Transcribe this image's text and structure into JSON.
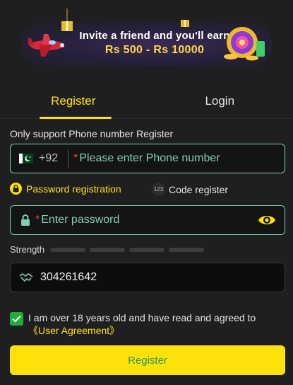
{
  "banner": {
    "line1": "Invite a friend and you'll earn",
    "line2": "Rs 500 - Rs 10000"
  },
  "tabs": [
    {
      "label": "Register",
      "active": true
    },
    {
      "label": "Login",
      "active": false
    }
  ],
  "note": "Only support Phone number Register",
  "phone": {
    "country_code": "+92",
    "required_mark": "*",
    "placeholder": "Please enter Phone number",
    "value": ""
  },
  "modes": {
    "password_label": "Password registration",
    "code_badge": "123",
    "code_label": "Code register",
    "selected": "password"
  },
  "password": {
    "required_mark": "*",
    "placeholder": "Enter password",
    "value": ""
  },
  "strength": {
    "label": "Strength",
    "filled_segments": 0,
    "total_segments": 4
  },
  "invite_code": {
    "value": "304261642"
  },
  "agreement": {
    "checked": true,
    "text": "I am over 18 years old and have read and agreed to",
    "link": "《User Agreement》"
  },
  "submit": {
    "label": "Register"
  },
  "colors": {
    "accent": "#ffe10a",
    "field_border": "#7ecfb3",
    "check": "#1fae3a",
    "required": "#e04848",
    "background": "#1f1f21"
  },
  "icons": {
    "flag": "pakistan-flag-icon",
    "lock": "lock-icon",
    "eye": "eye-icon",
    "handshake": "handshake-icon",
    "check": "checkmark-icon"
  }
}
